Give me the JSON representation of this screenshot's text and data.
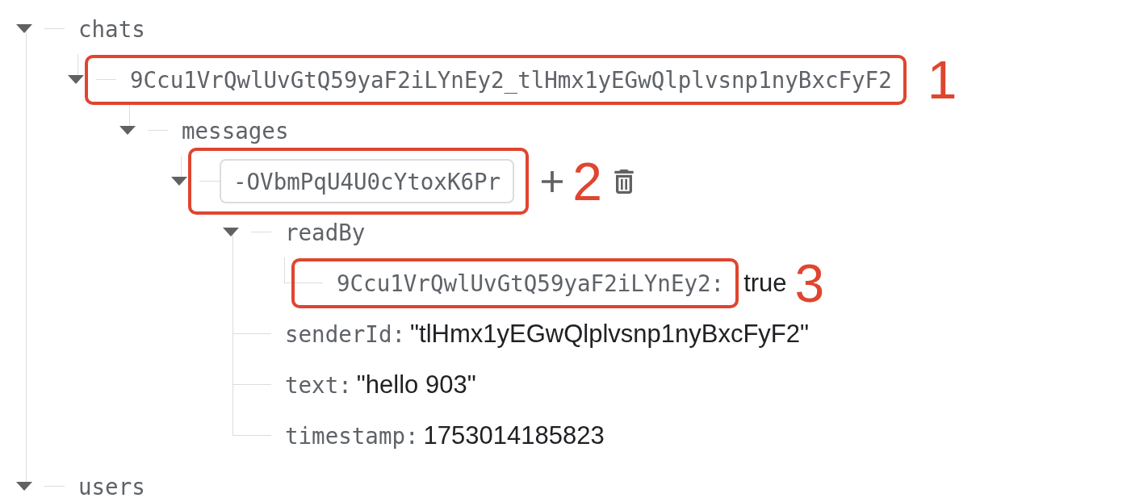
{
  "tree": [
    {
      "key": "chats",
      "expanded": true,
      "children": [
        {
          "key": "9Ccu1VrQwlUvGtQ59yaF2iLYnEy2_tlHmx1yEGwQlplvsnp1nyBxcFyF2",
          "expanded": true,
          "annotation": "1",
          "children": [
            {
              "key": "messages",
              "expanded": true,
              "children": [
                {
                  "key": "-OVbmPqU4U0cYtoxK6Pr",
                  "expanded": true,
                  "editing": true,
                  "add": true,
                  "delete": true,
                  "annotation": "2",
                  "children": [
                    {
                      "key": "readBy",
                      "expanded": true,
                      "children": [
                        {
                          "key": "9Ccu1VrQwlUvGtQ59yaF2iLYnEy2:",
                          "value": "true",
                          "annotation": "3"
                        }
                      ]
                    },
                    {
                      "key": "senderId:",
                      "value": "\"tlHmx1yEGwQlplvsnp1nyBxcFyF2\""
                    },
                    {
                      "key": "text:",
                      "value": "\"hello 903\""
                    },
                    {
                      "key": "timestamp:",
                      "value": "1753014185823"
                    }
                  ]
                }
              ]
            }
          ]
        }
      ]
    },
    {
      "key": "users",
      "expanded": true
    }
  ]
}
